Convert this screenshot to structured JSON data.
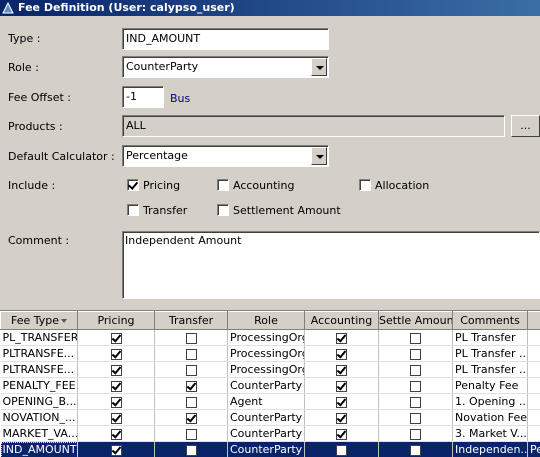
{
  "window": {
    "title": "Fee Definition (User: calypso_user)"
  },
  "form": {
    "type_label": "Type :",
    "type_value": "IND_AMOUNT",
    "role_label": "Role :",
    "role_value": "CounterParty",
    "fee_offset_label": "Fee Offset :",
    "fee_offset_value": "-1",
    "fee_offset_unit": "Bus",
    "products_label": "Products :",
    "products_value": "ALL",
    "products_button": "...",
    "default_calc_label": "Default Calculator :",
    "default_calc_value": "Percentage",
    "include_label": "Include :",
    "include": {
      "pricing": {
        "label": "Pricing",
        "checked": true
      },
      "accounting": {
        "label": "Accounting",
        "checked": false
      },
      "allocation": {
        "label": "Allocation",
        "checked": false
      },
      "transfer": {
        "label": "Transfer",
        "checked": false
      },
      "settlement_amount": {
        "label": "Settlement Amount",
        "checked": false
      }
    },
    "comment_label": "Comment :",
    "comment_value": "Independent Amount"
  },
  "table": {
    "columns": [
      "Fee Type",
      "Pricing",
      "Transfer",
      "Role",
      "Accounting",
      "Settle Amount",
      "Comments"
    ],
    "rows": [
      {
        "fee_type": "PL_TRANSFER",
        "pricing": true,
        "transfer": false,
        "role": "ProcessingOrg",
        "accounting": true,
        "settle": false,
        "comments": "PL Transfer"
      },
      {
        "fee_type": "PLTRANSFE...",
        "pricing": true,
        "transfer": false,
        "role": "ProcessingOrg",
        "accounting": true,
        "settle": false,
        "comments": "PL Transfer ..."
      },
      {
        "fee_type": "PLTRANSFE...",
        "pricing": true,
        "transfer": false,
        "role": "ProcessingOrg",
        "accounting": true,
        "settle": false,
        "comments": "PL Transfer ..."
      },
      {
        "fee_type": "PENALTY_FEE",
        "pricing": true,
        "transfer": true,
        "role": "CounterParty",
        "accounting": true,
        "settle": false,
        "comments": "Penalty Fee"
      },
      {
        "fee_type": "OPENING_B...",
        "pricing": true,
        "transfer": false,
        "role": "Agent",
        "accounting": true,
        "settle": false,
        "comments": "1. Opening ..."
      },
      {
        "fee_type": "NOVATION_...",
        "pricing": true,
        "transfer": true,
        "role": "CounterParty",
        "accounting": true,
        "settle": false,
        "comments": "Novation Fee"
      },
      {
        "fee_type": "MARKET_VA...",
        "pricing": true,
        "transfer": false,
        "role": "CounterParty",
        "accounting": true,
        "settle": false,
        "comments": "3. Market V..."
      },
      {
        "fee_type": "IND_AMOUNT",
        "pricing": true,
        "transfer": false,
        "role": "CounterParty",
        "accounting": false,
        "settle": false,
        "comments": "Independen...",
        "extra": "Pe",
        "selected": true
      }
    ]
  },
  "colors": {
    "title_bar": "#0a246a",
    "selection": "#0a246a",
    "window_bg": "#d4d0c8"
  }
}
